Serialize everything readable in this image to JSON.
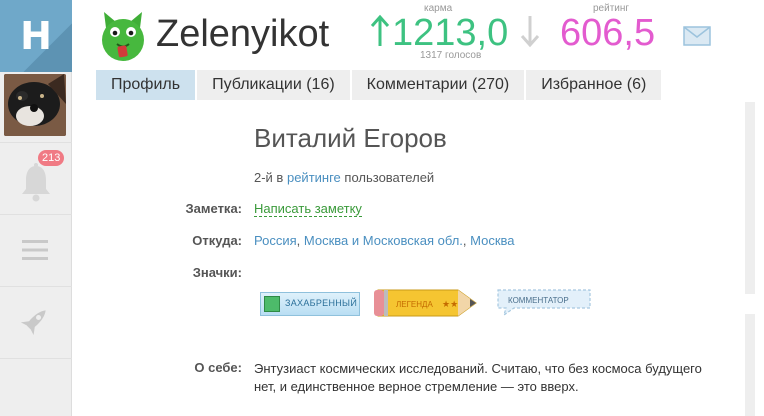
{
  "sidebar": {
    "logo_letter": "H",
    "notifications_count": "213",
    "icons": [
      "bell-icon",
      "menu-icon",
      "rocket-icon"
    ]
  },
  "header": {
    "username": "Zelenyikot",
    "karma_label": "карма",
    "karma_value": "1213,0",
    "karma_votes": "1317 голосов",
    "rating_label": "рейтинг",
    "rating_value": "606,5",
    "colors": {
      "karma": "#3dc281",
      "rating": "#e35bcf",
      "accent": "#6fa8c9"
    }
  },
  "tabs": [
    {
      "label": "Профиль",
      "active": true
    },
    {
      "label": "Публикации (16)",
      "active": false
    },
    {
      "label": "Комментарии (270)",
      "active": false
    },
    {
      "label": "Избранное (6)",
      "active": false
    }
  ],
  "profile": {
    "full_name": "Виталий Егоров",
    "rank_prefix": "2-й в",
    "rank_link": "рейтинге",
    "rank_suffix": "пользователей",
    "note_label": "Заметка:",
    "note_link": "Написать заметку",
    "from_label": "Откуда:",
    "from_links": [
      "Россия",
      "Москва и Московская обл.",
      "Москва"
    ],
    "badges_label": "Значки:",
    "badges": [
      "ЗАХАБРЕННЫЙ",
      "ЛЕГЕНДА",
      "КОММЕНТАТОР"
    ],
    "about_label": "О себе:",
    "about_text": "Энтузиаст космических исследований. Считаю, что без космоса будущего нет, и единственное верное стремление — это вверх."
  }
}
